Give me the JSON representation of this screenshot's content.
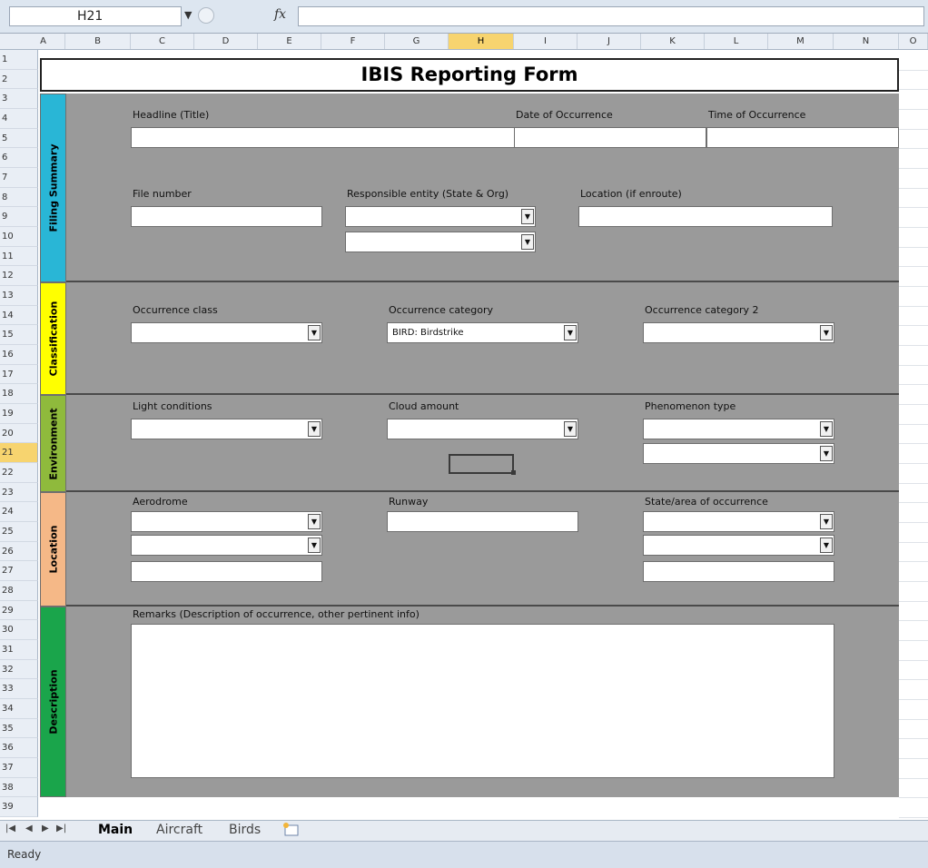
{
  "formula_bar": {
    "name_box": "H21",
    "fx_label": "fx",
    "formula": ""
  },
  "columns": [
    "A",
    "B",
    "C",
    "D",
    "E",
    "F",
    "G",
    "H",
    "I",
    "J",
    "K",
    "L",
    "M",
    "N",
    "O"
  ],
  "selected_column": "H",
  "rows": [
    "1",
    "2",
    "3",
    "4",
    "5",
    "6",
    "7",
    "8",
    "9",
    "10",
    "11",
    "12",
    "13",
    "14",
    "15",
    "16",
    "17",
    "18",
    "19",
    "20",
    "21",
    "22",
    "23",
    "24",
    "25",
    "26",
    "27",
    "28",
    "29",
    "30",
    "31",
    "32",
    "33",
    "34",
    "35",
    "36",
    "37",
    "38",
    "39"
  ],
  "selected_row": "21",
  "form": {
    "title": "IBIS Reporting Form",
    "filing_summary": {
      "band": "Filing Summary",
      "band_color": "#29b6d6",
      "headline_label": "Headline (Title)",
      "headline_value": "",
      "date_label": "Date of Occurrence",
      "date_value": "",
      "time_label": "Time of Occurrence",
      "time_value": "",
      "file_number_label": "File number",
      "file_number_value": "",
      "responsible_entity_label": "Responsible entity (State & Org)",
      "responsible_state_value": "",
      "responsible_org_value": "",
      "location_label": "Location (if enroute)",
      "location_value": ""
    },
    "classification": {
      "band": "Classification",
      "band_color": "#ffff00",
      "occurrence_class_label": "Occurrence class",
      "occurrence_class_value": "",
      "occurrence_category_label": "Occurrence category",
      "occurrence_category_value": "BIRD: Birdstrike",
      "occurrence_category2_label": "Occurrence category 2",
      "occurrence_category2_value": ""
    },
    "environment": {
      "band": "Environment",
      "band_color": "#8fba3c",
      "light_label": "Light conditions",
      "light_value": "",
      "cloud_label": "Cloud amount",
      "cloud_value": "",
      "phenomenon_label": "Phenomenon type",
      "phenomenon_value_1": "",
      "phenomenon_value_2": ""
    },
    "location": {
      "band": "Location",
      "band_color": "#f5b887",
      "aerodrome_label": "Aerodrome",
      "aerodrome_value_1": "",
      "aerodrome_value_2": "",
      "aerodrome_value_3": "",
      "runway_label": "Runway",
      "runway_value": "",
      "state_area_label": "State/area of occurrence",
      "state_area_value_1": "",
      "state_area_value_2": "",
      "state_area_value_3": ""
    },
    "description": {
      "band": "Description",
      "band_color": "#1aa54b",
      "remarks_label": "Remarks (Description of occurrence, other pertinent info)",
      "remarks_value": ""
    }
  },
  "sheet_tabs": [
    "Main",
    "Aircraft",
    "Birds"
  ],
  "active_tab": "Main",
  "status": "Ready"
}
